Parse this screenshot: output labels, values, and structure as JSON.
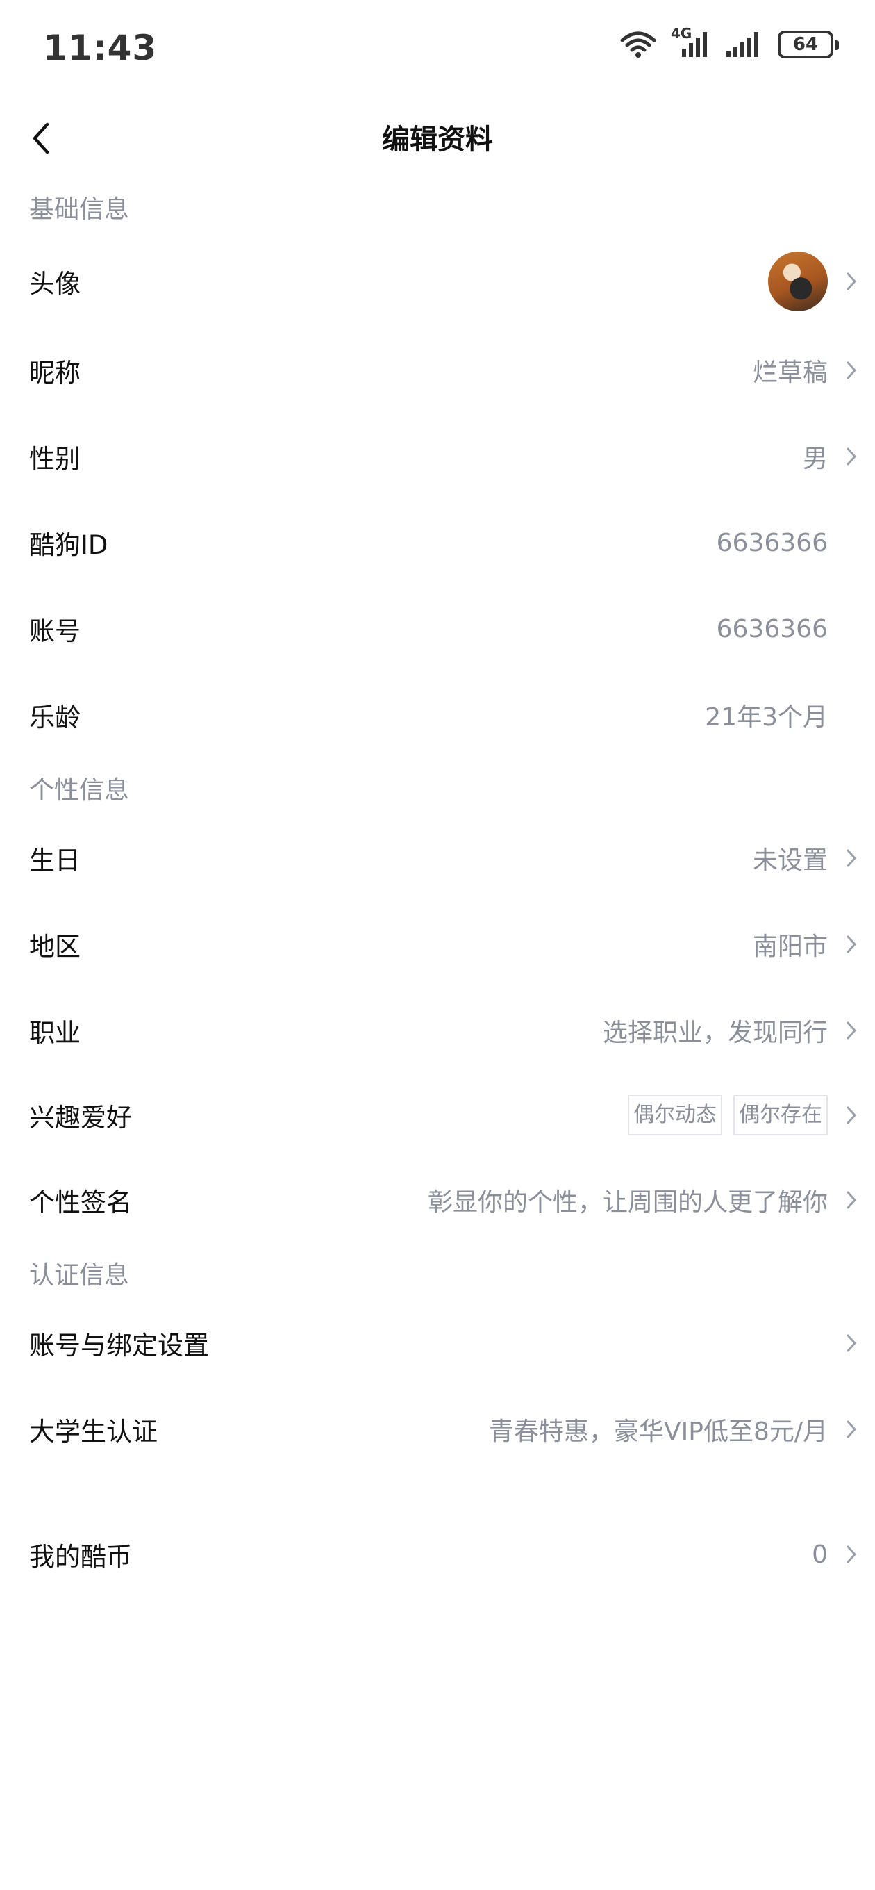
{
  "status_bar": {
    "time": "11:43",
    "network": "4G",
    "battery": "64"
  },
  "nav": {
    "title": "编辑资料"
  },
  "sections": {
    "basic": "基础信息",
    "personal": "个性信息",
    "auth": "认证信息"
  },
  "rows": {
    "avatar": {
      "label": "头像"
    },
    "nickname": {
      "label": "昵称",
      "value": "烂草稿"
    },
    "gender": {
      "label": "性别",
      "value": "男"
    },
    "kugou_id": {
      "label": "酷狗ID",
      "value": "6636366"
    },
    "account": {
      "label": "账号",
      "value": "6636366"
    },
    "music_age": {
      "label": "乐龄",
      "value": "21年3个月"
    },
    "birthday": {
      "label": "生日",
      "value": "未设置"
    },
    "region": {
      "label": "地区",
      "value": "南阳市"
    },
    "career": {
      "label": "职业",
      "value": "选择职业，发现同行"
    },
    "hobbies": {
      "label": "兴趣爱好",
      "tags": [
        "偶尔动态",
        "偶尔存在"
      ]
    },
    "signature": {
      "label": "个性签名",
      "value": "彰显你的个性，让周围的人更了解你"
    },
    "binding": {
      "label": "账号与绑定设置"
    },
    "student": {
      "label": "大学生认证",
      "value": "青春特惠，豪华VIP低至8元/月"
    },
    "coins": {
      "label": "我的酷币",
      "value": "0"
    }
  },
  "colors": {
    "label": "#111111",
    "muted": "#8a8f99",
    "background": "#ffffff"
  }
}
